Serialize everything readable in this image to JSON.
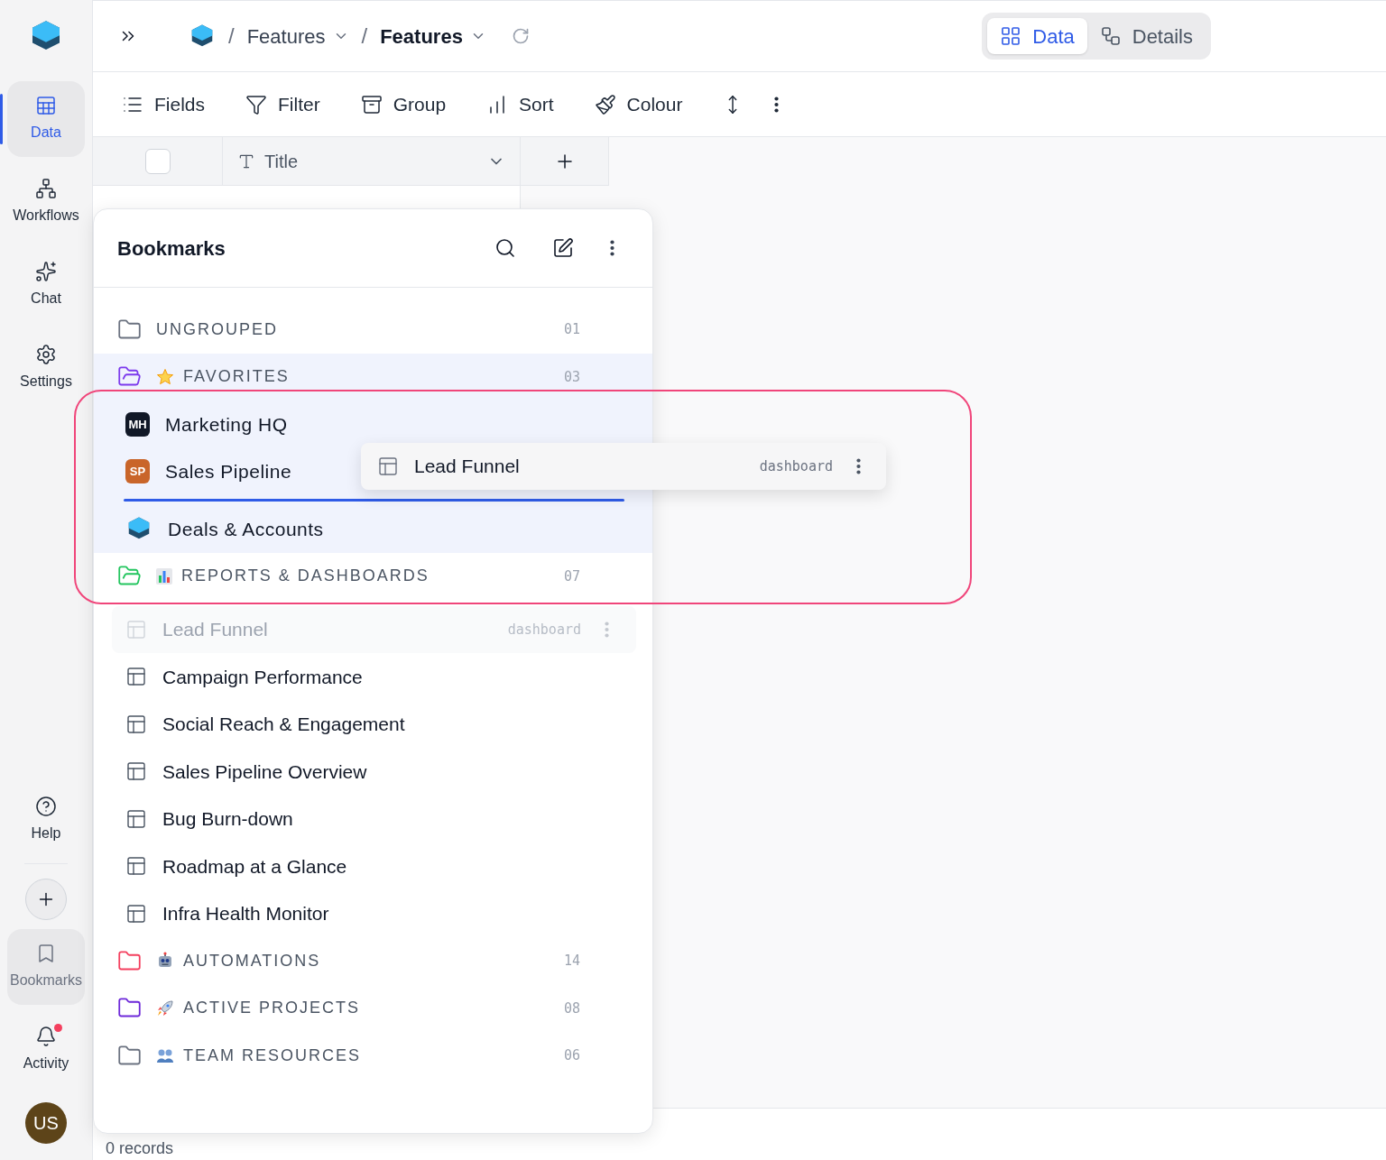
{
  "sidebar": {
    "top": [
      {
        "label": "Data",
        "selected": true
      },
      {
        "label": "Workflows",
        "selected": false
      },
      {
        "label": "Chat",
        "selected": false
      },
      {
        "label": "Settings",
        "selected": false
      }
    ],
    "bottom": [
      {
        "label": "Help",
        "selected": false
      },
      {
        "label": "Bookmarks",
        "selected": true
      },
      {
        "label": "Activity",
        "selected": false,
        "unread": true
      }
    ],
    "avatar": "US"
  },
  "breadcrumbs": [
    {
      "separator": "/",
      "label": "Features",
      "current": false
    },
    {
      "separator": "/",
      "label": "Features",
      "current": true
    }
  ],
  "view_toggle": [
    {
      "label": "Data",
      "selected": true
    },
    {
      "label": "Details",
      "selected": false
    }
  ],
  "toolbar": [
    "Fields",
    "Filter",
    "Group",
    "Sort",
    "Colour"
  ],
  "grid": {
    "select_all_checked": false,
    "columns": [
      "Title"
    ]
  },
  "footer": "0 records",
  "bookmarks": {
    "title": "Bookmarks",
    "groups": [
      {
        "name": "UNGROUPED",
        "count": "01",
        "color": "#6b7280",
        "expanded": false,
        "highlighted": false
      },
      {
        "name": "FAVORITES",
        "count": "03",
        "color": "#7c3aed",
        "expanded": true,
        "highlighted": true,
        "items": [
          {
            "kind": "avatar",
            "title": "Marketing HQ",
            "initials": "MH",
            "color": "#111827",
            "drop_below": false,
            "ghost": false
          },
          {
            "kind": "avatar",
            "title": "Sales Pipeline",
            "initials": "SP",
            "color": "#c9652a",
            "drop_below": true,
            "ghost": false
          },
          {
            "kind": "logo",
            "title": "Deals & Accounts",
            "drop_below": false,
            "ghost": false
          }
        ]
      },
      {
        "name": "REPORTS & DASHBOARDS",
        "count": "07",
        "color": "#22c55e",
        "expanded": true,
        "highlighted": false,
        "items": [
          {
            "kind": "view",
            "title": "Lead Funnel",
            "tag": "dashboard",
            "drop_below": false,
            "ghost": true
          },
          {
            "kind": "view",
            "title": "Campaign Performance",
            "drop_below": false,
            "ghost": false
          },
          {
            "kind": "view",
            "title": "Social Reach & Engagement",
            "drop_below": false,
            "ghost": false
          },
          {
            "kind": "view",
            "title": "Sales Pipeline Overview",
            "drop_below": false,
            "ghost": false
          },
          {
            "kind": "view",
            "title": "Bug Burn-down",
            "drop_below": false,
            "ghost": false
          },
          {
            "kind": "view",
            "title": "Roadmap at a Glance",
            "drop_below": false,
            "ghost": false
          },
          {
            "kind": "view",
            "title": "Infra Health Monitor",
            "drop_below": false,
            "ghost": false
          }
        ]
      },
      {
        "name": "AUTOMATIONS",
        "count": "14",
        "color": "#f43f5e",
        "expanded": false,
        "highlighted": false
      },
      {
        "name": "ACTIVE PROJECTS",
        "count": "08",
        "color": "#6d28d9",
        "expanded": false,
        "highlighted": false
      },
      {
        "name": "TEAM RESOURCES",
        "count": "06",
        "color": "#6b7280",
        "expanded": false,
        "highlighted": false
      }
    ]
  },
  "drag_preview": {
    "title": "Lead Funnel",
    "tag": "dashboard"
  }
}
